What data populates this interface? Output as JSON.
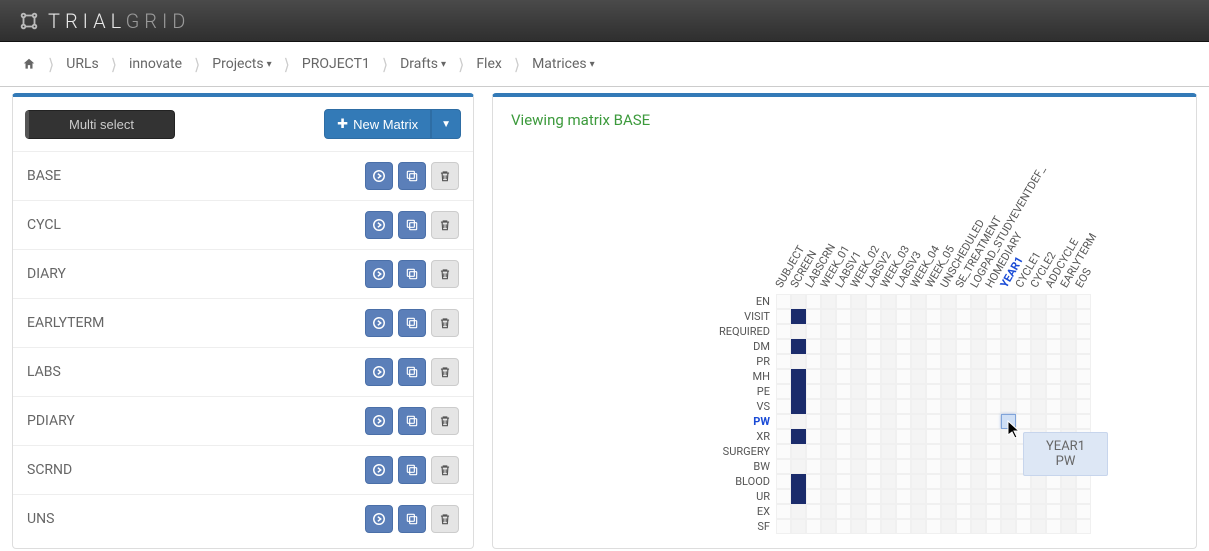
{
  "brand": {
    "trial": "TRIAL",
    "grid": "GRID"
  },
  "breadcrumb": [
    {
      "label": "",
      "icon": "home",
      "dropdown": false
    },
    {
      "label": "URLs",
      "dropdown": false
    },
    {
      "label": "innovate",
      "dropdown": false
    },
    {
      "label": "Projects",
      "dropdown": true
    },
    {
      "label": "PROJECT1",
      "dropdown": false
    },
    {
      "label": "Drafts",
      "dropdown": true
    },
    {
      "label": "Flex",
      "dropdown": false
    },
    {
      "label": "Matrices",
      "dropdown": true
    }
  ],
  "left": {
    "multi_select": "Multi select",
    "new_matrix": "New Matrix",
    "matrices": [
      {
        "name": "BASE"
      },
      {
        "name": "CYCL"
      },
      {
        "name": "DIARY"
      },
      {
        "name": "EARLYTERM"
      },
      {
        "name": "LABS"
      },
      {
        "name": "PDIARY"
      },
      {
        "name": "SCRND"
      },
      {
        "name": "UNS"
      }
    ]
  },
  "right": {
    "view_title": "Viewing matrix BASE",
    "columns": [
      "SUBJECT",
      "SCREEN",
      "LABSCRN",
      "WEEK_01",
      "LABSV1",
      "WEEK_02",
      "LABSV2",
      "WEEK_03",
      "LABSV3",
      "WEEK_04",
      "WEEK_05",
      "UNSCHEDULED",
      "SE_TREATMENT",
      "LOGPAD_STUDYEVENTDEF_",
      "HOMEDIARY",
      "YEAR1",
      "CYCLE1",
      "CYCLE2",
      "ADDCYCLE",
      "EARLYTERM",
      "EOS"
    ],
    "active_col": "YEAR1",
    "rows": [
      "EN",
      "VISIT",
      "REQUIRED",
      "DM",
      "PR",
      "MH",
      "PE",
      "VS",
      "PW",
      "XR",
      "SURGERY",
      "BW",
      "BLOOD",
      "UR",
      "EX",
      "SF"
    ],
    "active_row": "PW",
    "filled": {
      "VISIT": [
        "SCREEN"
      ],
      "DM": [
        "SCREEN"
      ],
      "MH": [
        "SCREEN"
      ],
      "PE": [
        "SCREEN"
      ],
      "VS": [
        "SCREEN"
      ],
      "XR": [
        "SCREEN"
      ],
      "BLOOD": [
        "SCREEN"
      ],
      "UR": [
        "SCREEN"
      ]
    },
    "hover_cell": {
      "row": "PW",
      "col": "YEAR1"
    },
    "tooltip": {
      "line1": "YEAR1",
      "line2": "PW"
    }
  }
}
